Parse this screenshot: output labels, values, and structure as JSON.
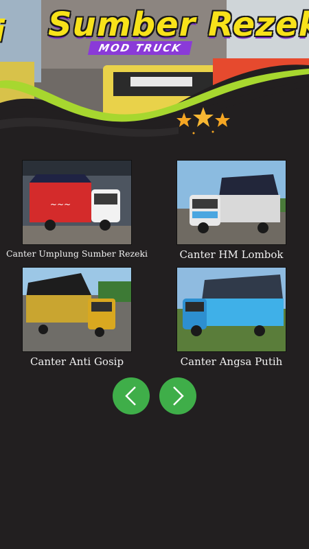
{
  "banner": {
    "title": "Sumber Rezeki",
    "subtitle": "MOD TRUCK",
    "left_logo": "i",
    "colors": {
      "title": "#f8e21a",
      "subtitle_bg": "#8a3ad8",
      "wave_green": "#a7d72f",
      "background": "#221f20"
    }
  },
  "items": [
    {
      "label": "Canter Umplung Sumber Rezeki",
      "icon": "truck-thumbnail"
    },
    {
      "label": "Canter HM Lombok",
      "icon": "truck-thumbnail"
    },
    {
      "label": "Canter Anti Gosip",
      "icon": "truck-thumbnail"
    },
    {
      "label": "Canter Angsa Putih",
      "icon": "truck-thumbnail"
    }
  ],
  "navigation": {
    "prev_icon": "chevron-left-icon",
    "next_icon": "chevron-right-icon",
    "button_color": "#3fae49"
  }
}
